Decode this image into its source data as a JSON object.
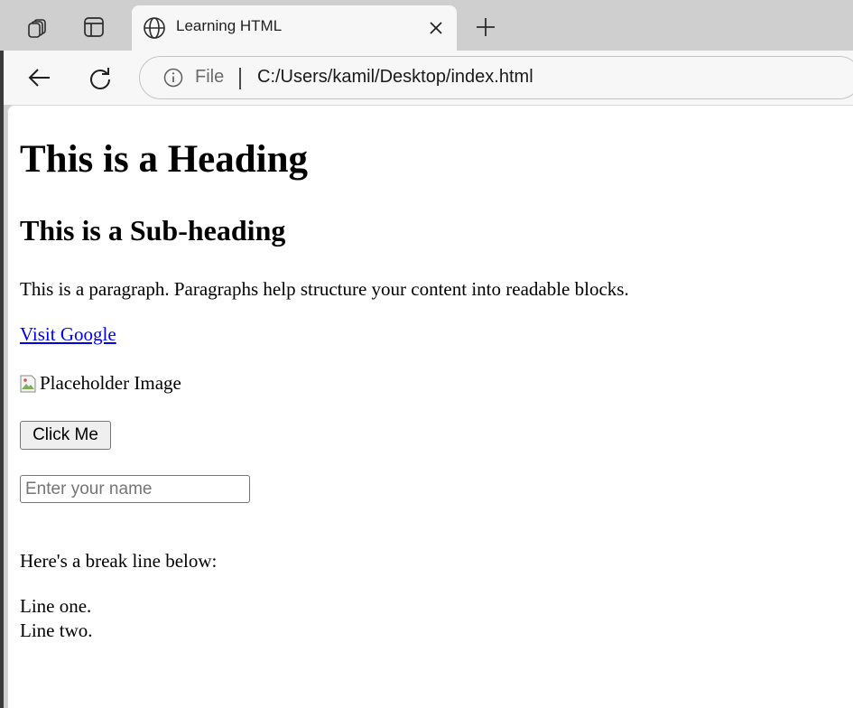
{
  "browser": {
    "tab": {
      "title": "Learning HTML"
    },
    "address_bar": {
      "scheme_label": "File",
      "url": "C:/Users/kamil/Desktop/index.html"
    }
  },
  "page": {
    "heading": "This is a Heading",
    "subheading": "This is a Sub-heading",
    "paragraph": "This is a paragraph. Paragraphs help structure your content into readable blocks.",
    "link_text": "Visit Google",
    "image_alt": "Placeholder Image",
    "button_label": "Click Me",
    "name_input": {
      "placeholder": "Enter your name",
      "value": ""
    },
    "break_intro": "Here's a break line below:",
    "line_one": "Line one.",
    "line_two": "Line two."
  }
}
